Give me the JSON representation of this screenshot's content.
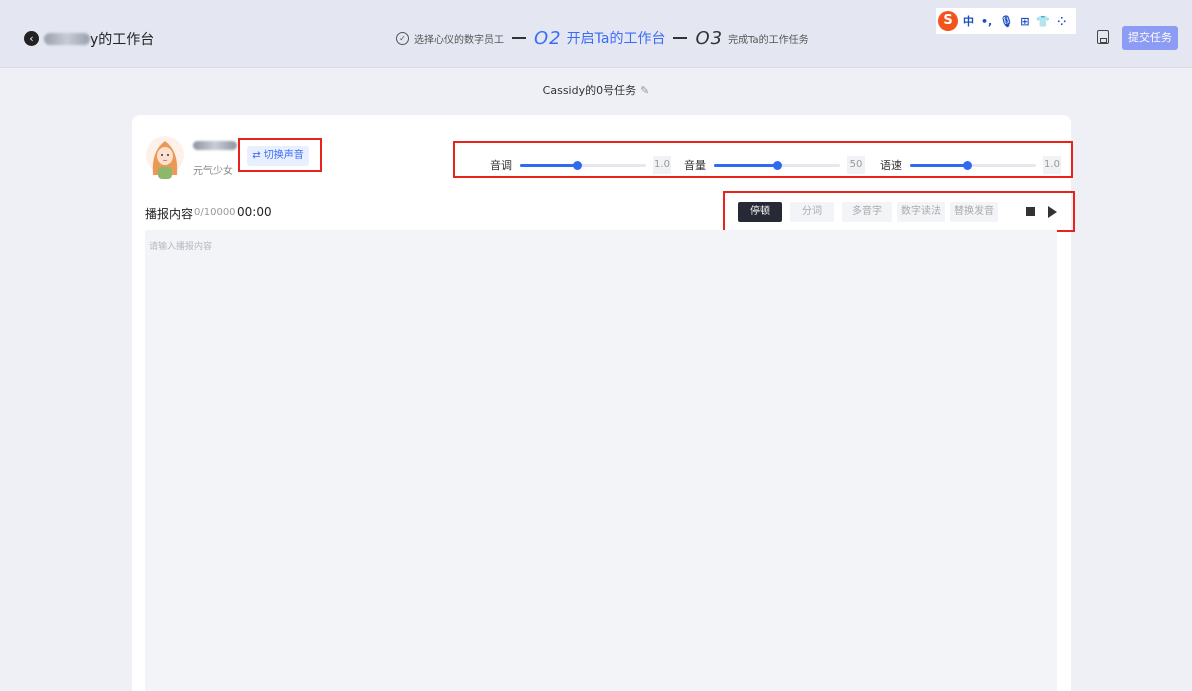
{
  "header": {
    "title_suffix": "y的工作台",
    "steps": {
      "step1_label": "选择心仪的数字员工",
      "step2_num": "O2",
      "step2_label": "开启Ta的工作台",
      "step3_num": "O3",
      "step3_label": "完成Ta的工作任务"
    },
    "ime": {
      "logo": "S",
      "items": [
        "中",
        "•,",
        "🎙",
        "⊞",
        "👕",
        "⁘"
      ]
    },
    "submit_label": "提交任务"
  },
  "task": {
    "title": "Cassidy的0号任务"
  },
  "voice": {
    "description": "元气少女",
    "switch_label": "⇄ 切换声音"
  },
  "sliders": [
    {
      "label": "音调",
      "value": "1.0",
      "fraction": 0.45
    },
    {
      "label": "音量",
      "value": "50",
      "fraction": 0.5
    },
    {
      "label": "语速",
      "value": "1.0",
      "fraction": 0.45
    }
  ],
  "content": {
    "label": "播报内容",
    "char_count": "0/10000",
    "duration": "00:00",
    "placeholder": "请输入播报内容"
  },
  "toolbar": {
    "pause": "停顿",
    "segment": "分词",
    "polyphone": "多音字",
    "number_reading": "数字读法",
    "replace_pronunciation": "替换发音"
  },
  "colors": {
    "accent": "#3b6cf6",
    "submit_bg": "#8c9bf3",
    "highlight_box": "#e8231b"
  }
}
